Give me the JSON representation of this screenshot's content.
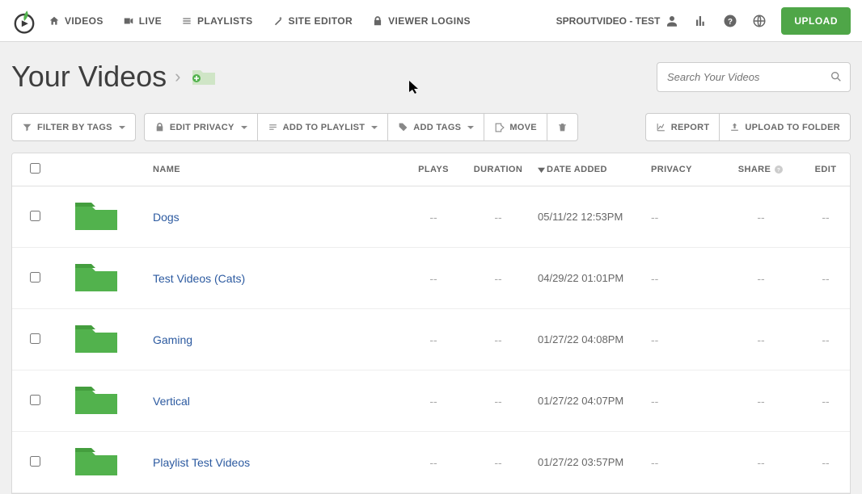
{
  "nav": {
    "videos": "VIDEOS",
    "live": "LIVE",
    "playlists": "PLAYLISTS",
    "site_editor": "SITE EDITOR",
    "viewer_logins": "VIEWER LOGINS",
    "account": "SPROUTVIDEO - TEST",
    "upload": "UPLOAD"
  },
  "header": {
    "title": "Your Videos",
    "search_placeholder": "Search Your Videos"
  },
  "toolbar": {
    "filter": "FILTER BY TAGS",
    "edit_privacy": "EDIT PRIVACY",
    "add_to_playlist": "ADD TO PLAYLIST",
    "add_tags": "ADD TAGS",
    "move": "MOVE",
    "report": "REPORT",
    "upload_to_folder": "UPLOAD TO FOLDER"
  },
  "columns": {
    "name": "NAME",
    "plays": "PLAYS",
    "duration": "DURATION",
    "date_added": "DATE ADDED",
    "privacy": "PRIVACY",
    "share": "SHARE",
    "edit": "EDIT"
  },
  "rows": [
    {
      "name": "Dogs",
      "plays": "--",
      "duration": "--",
      "date": "05/11/22 12:53PM",
      "privacy": "--",
      "share": "--",
      "edit": "--"
    },
    {
      "name": "Test Videos (Cats)",
      "plays": "--",
      "duration": "--",
      "date": "04/29/22 01:01PM",
      "privacy": "--",
      "share": "--",
      "edit": "--"
    },
    {
      "name": "Gaming",
      "plays": "--",
      "duration": "--",
      "date": "01/27/22 04:08PM",
      "privacy": "--",
      "share": "--",
      "edit": "--"
    },
    {
      "name": "Vertical",
      "plays": "--",
      "duration": "--",
      "date": "01/27/22 04:07PM",
      "privacy": "--",
      "share": "--",
      "edit": "--"
    },
    {
      "name": "Playlist Test Videos",
      "plays": "--",
      "duration": "--",
      "date": "01/27/22 03:57PM",
      "privacy": "--",
      "share": "--",
      "edit": "--"
    }
  ]
}
